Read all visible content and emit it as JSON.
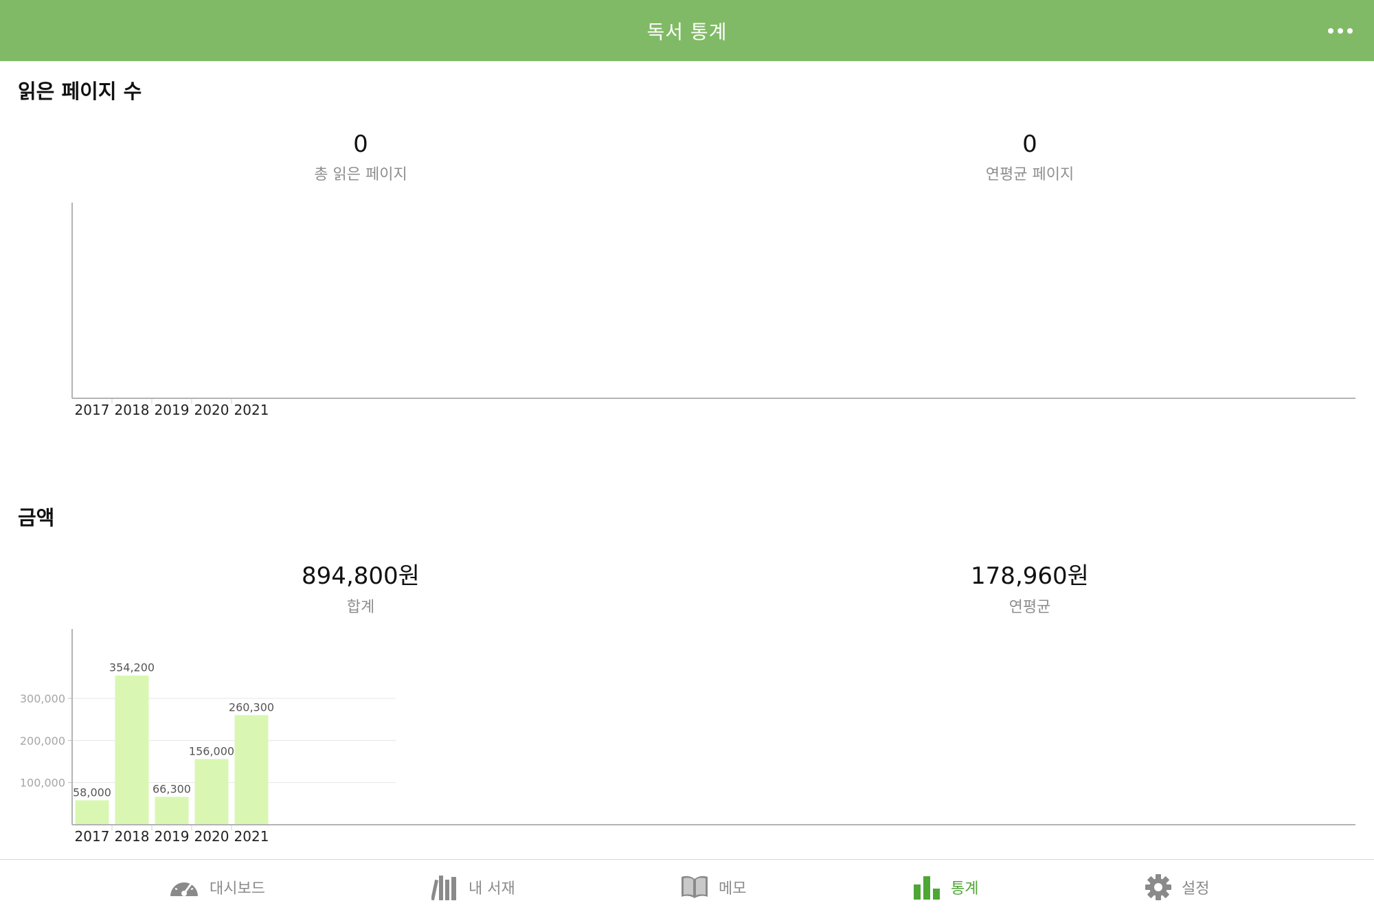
{
  "header": {
    "title": "독서 통계"
  },
  "pages_section": {
    "title": "읽은 페이지 수",
    "total": {
      "value": "0",
      "label": "총 읽은 페이지"
    },
    "yearly_avg": {
      "value": "0",
      "label": "연평균 페이지"
    }
  },
  "amount_section": {
    "title": "금액",
    "total": {
      "value": "894,800원",
      "label": "합계"
    },
    "yearly_avg": {
      "value": "178,960원",
      "label": "연평균"
    }
  },
  "chart_data": [
    {
      "type": "bar",
      "categories": [
        "2017",
        "2018",
        "2019",
        "2020",
        "2021"
      ],
      "values": [
        0,
        0,
        0,
        0,
        0
      ],
      "title": "",
      "xlabel": "",
      "ylabel": ""
    },
    {
      "type": "bar",
      "categories": [
        "2017",
        "2018",
        "2019",
        "2020",
        "2021"
      ],
      "values": [
        58000,
        354200,
        66300,
        156000,
        260300
      ],
      "value_labels": [
        "58,000",
        "354,200",
        "66,300",
        "156,000",
        "260,300"
      ],
      "yticks": [
        100000,
        200000,
        300000
      ],
      "ytick_labels": [
        "100,000",
        "200,000",
        "300,000"
      ],
      "ylim": [
        0,
        432000
      ],
      "grid": true,
      "bar_color": "#d9f7b2",
      "title": "",
      "xlabel": "",
      "ylabel": ""
    }
  ],
  "tabbar": {
    "items": [
      {
        "label": "대시보드",
        "icon": "speedometer-icon",
        "active": false
      },
      {
        "label": "내 서재",
        "icon": "bookshelf-icon",
        "active": false
      },
      {
        "label": "메모",
        "icon": "book-icon",
        "active": false
      },
      {
        "label": "통계",
        "icon": "bar-chart-icon",
        "active": true
      },
      {
        "label": "설정",
        "icon": "gear-icon",
        "active": false
      }
    ]
  },
  "colors": {
    "accent": "#80ba66",
    "active_tab": "#4ea635",
    "bar": "#d9f7b2",
    "inactive_icon": "#8a8a8a"
  }
}
